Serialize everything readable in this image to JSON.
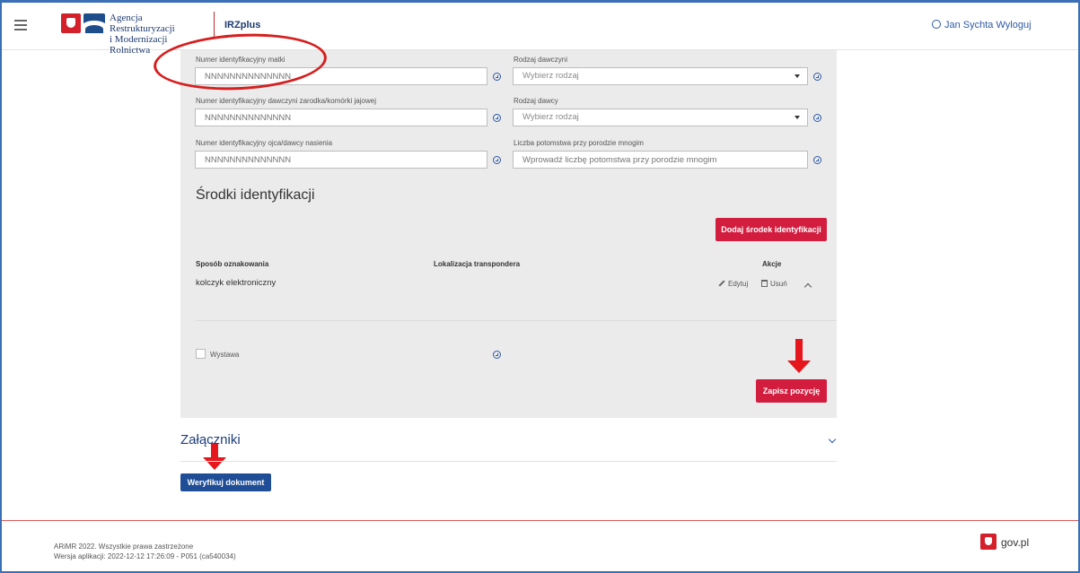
{
  "header": {
    "agency_line1": "Agencja Restrukturyzacji",
    "agency_line2": "i Modernizacji Rolnictwa",
    "app_name": "IRZplus",
    "user": "Jan Sychta",
    "logout": "Wyloguj"
  },
  "form": {
    "mother_id": {
      "label": "Numer identyfikacyjny matki",
      "placeholder": "NNNNNNNNNNNNNN"
    },
    "donor_female_type": {
      "label": "Rodzaj dawczyni",
      "placeholder": "Wybierz rodzaj"
    },
    "embryo_donor_id": {
      "label": "Numer identyfikacyjny dawczyni zarodka/komórki jajowej",
      "placeholder": "NNNNNNNNNNNNNN"
    },
    "donor_type": {
      "label": "Rodzaj dawcy",
      "placeholder": "Wybierz rodzaj"
    },
    "father_id": {
      "label": "Numer identyfikacyjny ojca/dawcy nasienia",
      "placeholder": "NNNNNNNNNNNNNN"
    },
    "offspring_count": {
      "label": "Liczba potomstwa przy porodzie mnogim",
      "placeholder": "Wprowadź liczbę potomstwa przy porodzie mnogim"
    }
  },
  "identification": {
    "title": "Środki identyfikacji",
    "add_button": "Dodaj środek identyfikacji",
    "columns": [
      "Sposób oznakowania",
      "Lokalizacja transpondera",
      "Akcje"
    ],
    "rows": [
      {
        "method": "kolczyk elektroniczny",
        "location": ""
      }
    ],
    "edit_label": "Edytuj",
    "delete_label": "Usuń"
  },
  "exhibition_label": "Wystawa",
  "save_button": "Zapisz pozycję",
  "attachments": {
    "title": "Załączniki",
    "verify_button": "Weryfikuj dokument"
  },
  "footer": {
    "copyright": "ARiMR 2022. Wszystkie prawa zastrzeżone",
    "version": "Wersja aplikacji: 2022-12-12 17:26:09 - P051 (ca540034)",
    "gov": "gov.pl"
  },
  "colors": {
    "accent_red": "#d31d3f",
    "primary_blue": "#1f4e97",
    "annotation_red": "#e5161c"
  },
  "icons": [
    "menu-icon",
    "help-icon",
    "chevron-down-icon",
    "chevron-up-icon",
    "edit-icon",
    "trash-icon",
    "user-icon",
    "gov-flag-icon"
  ]
}
